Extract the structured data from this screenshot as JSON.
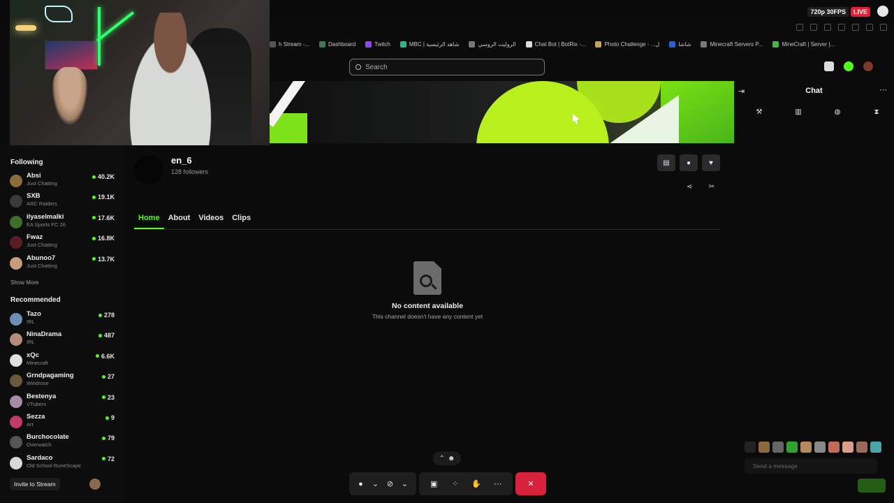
{
  "stream_overlay": {
    "quality": "720p 30FPS",
    "live_label": "LIVE"
  },
  "bookmarks": [
    {
      "label": "h Stream -...",
      "color": "#555555"
    },
    {
      "label": "Dashboard",
      "color": "#3a7d52"
    },
    {
      "label": "Twitch",
      "color": "#9146ff"
    },
    {
      "label": "MBC | شاهد الرئيسية",
      "color": "#2bb58c"
    },
    {
      "label": "الروليت الروسي",
      "color": "#777777"
    },
    {
      "label": "Chat Bot | BotRix -...",
      "color": "#dddddd"
    },
    {
      "label": "Photo Challenge - ...ل",
      "color": "#c4a35a"
    },
    {
      "label": "شاشا",
      "color": "#2266cc"
    },
    {
      "label": "Minecraft Servers P...",
      "color": "#777777"
    },
    {
      "label": "MineCraft | Server |...",
      "color": "#4caf50"
    }
  ],
  "search": {
    "placeholder": "Search"
  },
  "sidebar": {
    "following_title": "Following",
    "following": [
      {
        "name": "Absi",
        "category": "Just Chatting",
        "viewers": "40.2K",
        "avatar": "#8a6d3b"
      },
      {
        "name": "SXB",
        "category": "ARC Raiders",
        "viewers": "19.1K",
        "avatar": "#3b3b3b"
      },
      {
        "name": "ilyaselmalki",
        "category": "EA Sports FC 26",
        "viewers": "17.6K",
        "avatar": "#3f6e2a"
      },
      {
        "name": "Fwaz",
        "category": "Just Chatting",
        "viewers": "16.8K",
        "avatar": "#5a1d22"
      },
      {
        "name": "Abunoo7",
        "category": "Just Chatting",
        "viewers": "13.7K",
        "avatar": "#c69c7c"
      }
    ],
    "show_more": "Show More",
    "recommended_title": "Recommended",
    "recommended": [
      {
        "name": "Tazo",
        "category": "IRL",
        "viewers": "278",
        "avatar": "#6b8fb5"
      },
      {
        "name": "NinaDrama",
        "category": "IRL",
        "viewers": "487",
        "avatar": "#b58c7a"
      },
      {
        "name": "xQc",
        "category": "Minecraft",
        "viewers": "6.6K",
        "avatar": "#e0e0e0"
      },
      {
        "name": "Grndpagaming",
        "category": "Windrose",
        "viewers": "27",
        "avatar": "#6b5a3a"
      },
      {
        "name": "Bestenya",
        "category": "VTubers",
        "viewers": "23",
        "avatar": "#a88aa8"
      },
      {
        "name": "Sezza",
        "category": "Art",
        "viewers": "9",
        "avatar": "#c23a6a"
      },
      {
        "name": "Burchocolate",
        "category": "Overwatch",
        "viewers": "79",
        "avatar": "#555555"
      },
      {
        "name": "Sardaco",
        "category": "Old School RuneScape",
        "viewers": "72",
        "avatar": "#d8d8d8"
      }
    ]
  },
  "channel": {
    "name": "en_6",
    "followers": "128 followers",
    "tabs": [
      "Home",
      "About",
      "Videos",
      "Clips"
    ],
    "active_tab": "Home"
  },
  "empty_state": {
    "title": "No content available",
    "subtitle": "This channel doesn't have any content yet"
  },
  "chat": {
    "title": "Chat",
    "placeholder": "Send a message"
  },
  "meeting": {
    "invite_label": "Invite to Stream"
  }
}
